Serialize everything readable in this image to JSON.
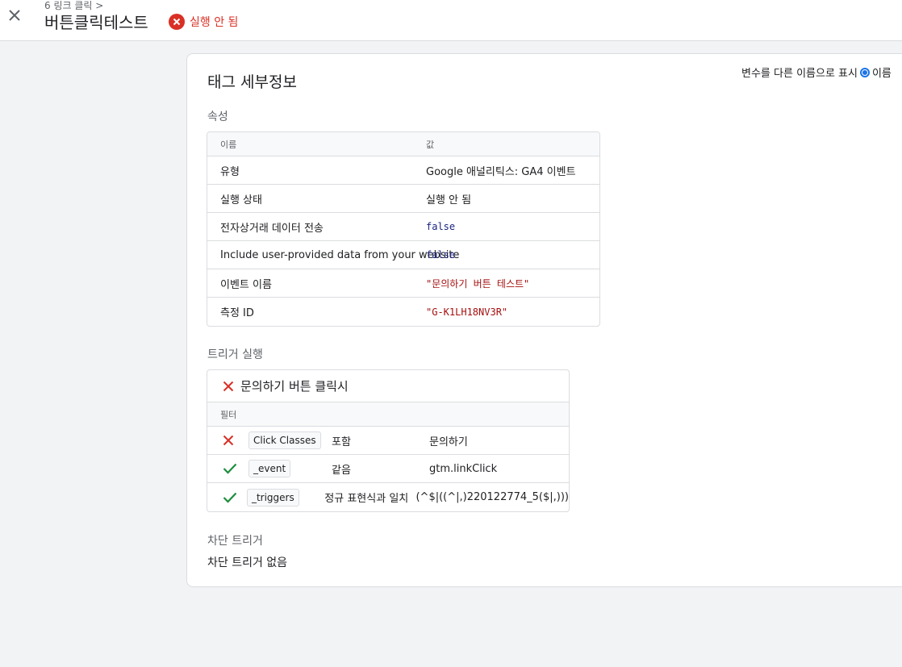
{
  "header": {
    "breadcrumb": "6 링크 클릭 >",
    "title": "버튼클릭테스트",
    "status_text": "실행 안 됨",
    "close_icon": "close-icon",
    "status_icon": "error-circle-icon",
    "status_color": "#d93025"
  },
  "card": {
    "title": "태그 세부정보",
    "var_toggle_label": "변수를 다른 이름으로 표시",
    "var_toggle_option": "이름",
    "var_toggle_selected": true,
    "properties_title": "속성",
    "properties_columns": [
      "이름",
      "값"
    ],
    "properties": [
      {
        "name": "유형",
        "value": "Google 애널리틱스: GA4 이벤트"
      },
      {
        "name": "실행 상태",
        "value": "실행 안 됨"
      },
      {
        "name": "전자상거래 데이터 전송",
        "value": "false"
      },
      {
        "name": "Include user-provided data from your website",
        "value": "false"
      },
      {
        "name": "이벤트 이름",
        "value": "\"문의하기 버튼 테스트\""
      },
      {
        "name": "측정 ID",
        "value": "\"G-K1LH18NV3R\""
      }
    ],
    "trigger_title": "트리거 실행",
    "trigger": {
      "name": "문의하기 버튼 클릭시",
      "fired": false,
      "filter_header": "필터",
      "filters": [
        {
          "passed": false,
          "variable": "Click Classes",
          "operator": "포함",
          "value": "문의하기"
        },
        {
          "passed": true,
          "variable": "_event",
          "operator": "같음",
          "value": "gtm.linkClick"
        },
        {
          "passed": true,
          "variable": "_triggers",
          "operator": "정규 표현식과 일치",
          "value": "(^$|((^|,)220122774_5($|,)))"
        }
      ]
    },
    "blocking_title": "차단 트리거",
    "blocking_none": "차단 트리거 없음"
  },
  "colors": {
    "fail": "#d93025",
    "pass": "#1e8e3e",
    "accent": "#1a73e8"
  }
}
